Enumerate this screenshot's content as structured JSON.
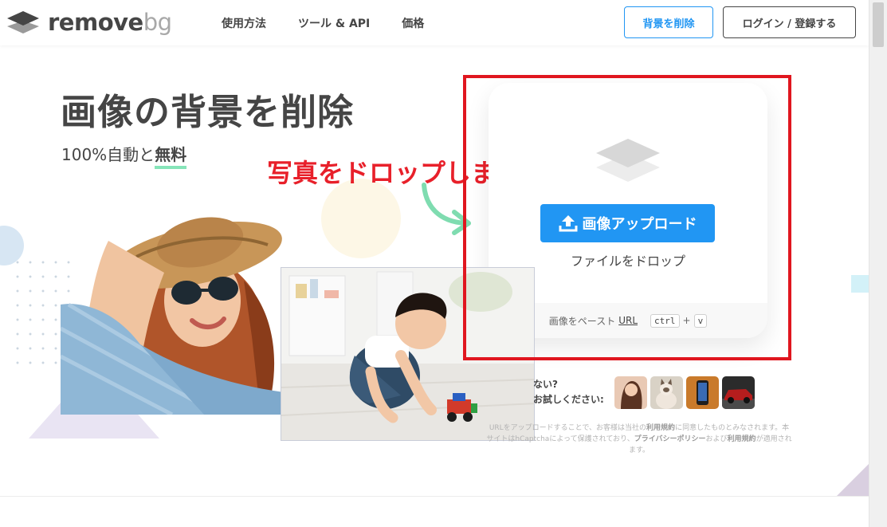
{
  "brand": {
    "name_part1": "remove",
    "name_part2": "bg"
  },
  "nav": {
    "items": [
      "使用方法",
      "ツール & API",
      "価格"
    ]
  },
  "header": {
    "remove_bg_button": "背景を削除",
    "login_button": "ログイン / 登録する"
  },
  "hero": {
    "title": "画像の背景を削除",
    "subtitle_prefix": "100%自動と",
    "subtitle_bold": "無料"
  },
  "annotation": {
    "text": "写真をドロップします"
  },
  "upload": {
    "button_label": "画像アップロード",
    "drop_text": "ファイルをドロップ",
    "paste_prefix": "画像をペースト",
    "paste_url": "URL",
    "key_ctrl": "ctrl",
    "key_plus": "+",
    "key_v": "v"
  },
  "samples": {
    "line1": "ない?",
    "line2": "お試しください:"
  },
  "legal": {
    "part1": "URLをアップロードすることで、お客様は当社の",
    "terms": "利用規約",
    "part2": "に同意したものとみなされます。本サイトはhCaptchaによって保護されており、",
    "privacy": "プライバシーポリシー",
    "part3": "および",
    "terms2": "利用規約",
    "part4": "が適用されます。"
  },
  "colors": {
    "accent": "#2196f3",
    "text": "#454545",
    "annotation_red": "#e8202a",
    "highlight_green": "#86e5b9"
  },
  "icons": [
    "logo-layers-icon",
    "upload-icon",
    "layers-icon",
    "curved-arrow-icon"
  ]
}
